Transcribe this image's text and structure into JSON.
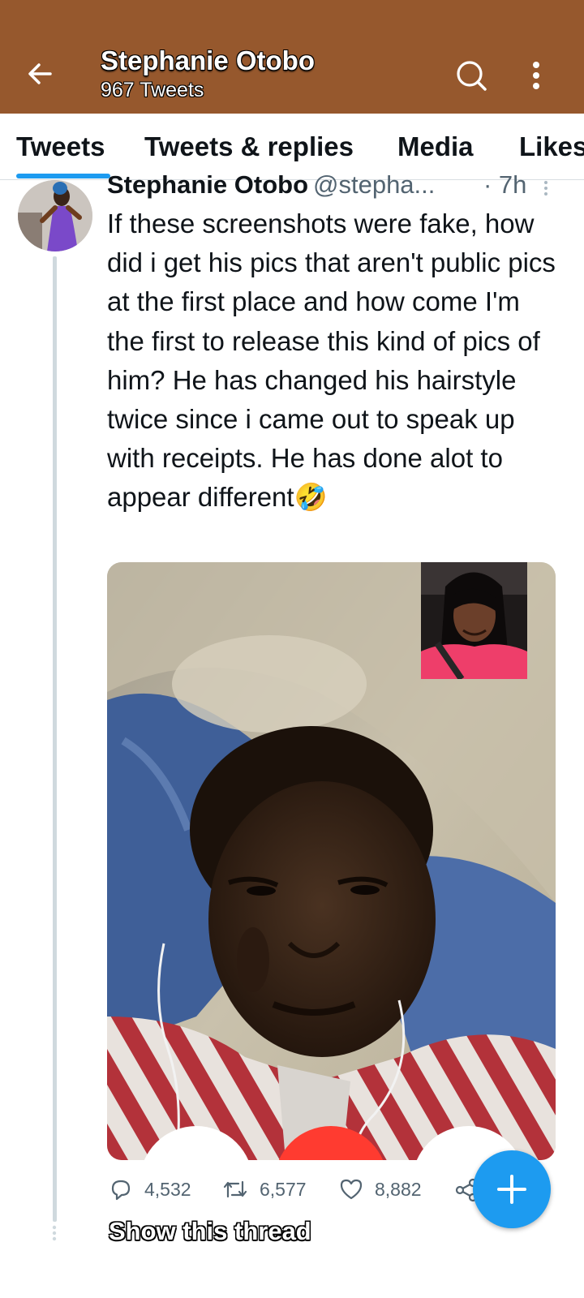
{
  "header": {
    "title": "Stephanie Otobo",
    "subtitle": "967 Tweets",
    "back_icon": "arrow-left-icon",
    "search_icon": "search-icon",
    "more_icon": "more-vertical-icon",
    "color": "#96582d"
  },
  "tabs": [
    {
      "label": "Tweets",
      "active": true
    },
    {
      "label": "Tweets & replies",
      "active": false
    },
    {
      "label": "Media",
      "active": false
    },
    {
      "label": "Likes",
      "active": false
    }
  ],
  "tweet": {
    "name": "Stephanie Otobo",
    "handle": "@stepha...",
    "time": "· 7h",
    "text": "If these screenshots were fake, how did i get his pics that aren't public  pics at the first place and how come I'm the first to release this kind of pics of him? He has changed his hairstyle twice since i came out to speak up with receipts. He has done alot to appear different",
    "emoji": "🤣",
    "media": {
      "type": "video-call-screenshot"
    },
    "actions": {
      "replies": "4,532",
      "retweets": "6,577",
      "likes": "8,882"
    },
    "show_thread": "Show this thread"
  },
  "accent_color": "#1d9bf0"
}
